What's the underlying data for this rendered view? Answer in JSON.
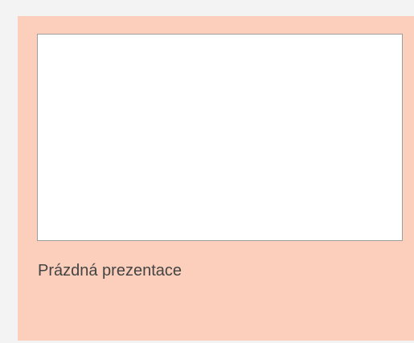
{
  "template": {
    "name": "Prázdná prezentace",
    "card_color": "#fbcfbb",
    "thumbnail_color": "#ffffff",
    "thumbnail_border": "#9e9e9e",
    "label_color": "#444444"
  },
  "background_color": "#f3f3f3"
}
